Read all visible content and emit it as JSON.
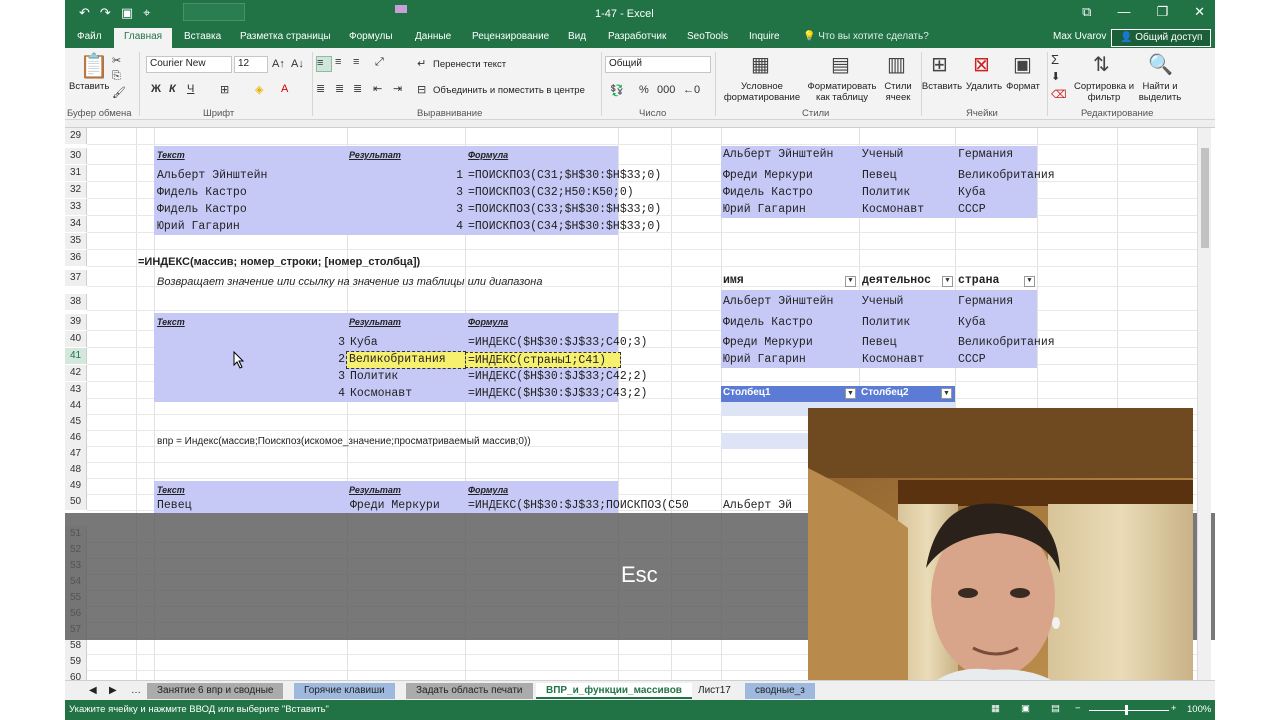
{
  "window": {
    "title": "1-47 - Excel",
    "user": "Max Uvarov",
    "share": "Общий доступ",
    "search_placeholder": "Что вы хотите сделать?"
  },
  "tabs": [
    "Файл",
    "Главная",
    "Вставка",
    "Разметка страницы",
    "Формулы",
    "Данные",
    "Рецензирование",
    "Вид",
    "Разработчик",
    "SeoTools",
    "Inquire"
  ],
  "ribbon": {
    "paste": "Вставить",
    "font_name": "Courier New",
    "font_size": "12",
    "wrap": "Перенести текст",
    "merge": "Объединить и поместить в центре",
    "number_format": "Общий",
    "cond_format": "Условное форматирование",
    "format_table": "Форматировать как таблицу",
    "cell_styles": "Стили ячеек",
    "insert": "Вставить",
    "delete": "Удалить",
    "format": "Формат",
    "sort": "Сортировка и фильтр",
    "find": "Найти и выделить",
    "groups": [
      "Буфер обмена",
      "Шрифт",
      "Выравнивание",
      "Число",
      "Стили",
      "Ячейки",
      "Редактирование"
    ],
    "bold": "Ж",
    "italic": "К",
    "underline": "Ч"
  },
  "rows": [
    "29",
    "30",
    "31",
    "32",
    "33",
    "34",
    "35",
    "36",
    "37",
    "38",
    "39",
    "40",
    "41",
    "42",
    "43",
    "44",
    "45",
    "46",
    "47",
    "48",
    "49",
    "50",
    "51",
    "52",
    "53",
    "54",
    "55",
    "56",
    "57",
    "58",
    "59",
    "60"
  ],
  "sheet": {
    "hdr_text": "Текст",
    "hdr_result": "Результат",
    "hdr_formula": "Формула",
    "b1": [
      {
        "text": "Альберт Эйнштейн",
        "num": "1",
        "formula": "=ПОИСКПОЗ(C31;$H$30:$H$33;0)"
      },
      {
        "text": "Фидель Кастро",
        "num": "3",
        "formula": "=ПОИСКПОЗ(C32;H50:K50;0)"
      },
      {
        "text": "Фидель Кастро",
        "num": "3",
        "formula": "=ПОИСКПОЗ(C33;$H$30:$H$33;0)"
      },
      {
        "text": "Юрий Гагарин",
        "num": "4",
        "formula": "=ПОИСКПОЗ(C34;$H$30:$H$33;0)"
      }
    ],
    "index_syntax": "=ИНДЕКС(массив; номер_строки; [номер_столбца])",
    "index_desc": "Возвращает значение или ссылку на значение из таблицы или диапазона",
    "b2": [
      {
        "num": "3",
        "result": "Куба",
        "formula": "=ИНДЕКС($H$30:$J$33;C40;3)"
      },
      {
        "num": "2",
        "result": "Великобритания",
        "formula": "=ИНДЕКС(страны1;C41)"
      },
      {
        "num": "3",
        "result": "Политик",
        "formula": "=ИНДЕКС($H$30:$J$33;C42;2)"
      },
      {
        "num": "4",
        "result": "Космонавт",
        "formula": "=ИНДЕКС($H$30:$J$33;C43;2)"
      }
    ],
    "vpr_note": "впр = Индекс(массив;Поискпоз(искомое_значение;просматриваемый массив;0))",
    "row50": {
      "text": "Певец",
      "result": "Фреди Меркури",
      "formula": "=ИНДЕКС($H$30:$J$33;ПОИСКПОЗ(C50"
    },
    "right1": [
      [
        "Альберт Эйнштейн",
        "Ученый",
        "Германия"
      ],
      [
        "Фреди Меркури",
        "Певец",
        "Великобритания"
      ],
      [
        "Фидель Кастро",
        "Политик",
        "Куба"
      ],
      [
        "Юрий Гагарин",
        "Космонавт",
        "СССР"
      ]
    ],
    "right2_hdr": [
      "имя",
      "деятельнос",
      "страна"
    ],
    "right2": [
      [
        "Альберт Эйнштейн",
        "Ученый",
        "Германия"
      ],
      [
        "Фидель Кастро",
        "Политик",
        "Куба"
      ],
      [
        "Фреди Меркури",
        "Певец",
        "Великобритания"
      ],
      [
        "Юрий Гагарин",
        "Космонавт",
        "СССР"
      ]
    ],
    "right3_hdr": [
      "Столбец1",
      "Столбец2"
    ],
    "right50": "Альберт Эй"
  },
  "overlay_key": "Esc",
  "sheet_tabs": [
    "Занятие 6 впр и сводные",
    "Горячие клавиши",
    "Задать область печати",
    "ВПР_и_функции_массивов",
    "Лист17",
    "сводные_з"
  ],
  "status": {
    "message": "Укажите ячейку и нажмите ВВОД или выберите \"Вставить\"",
    "zoom": "100%"
  }
}
